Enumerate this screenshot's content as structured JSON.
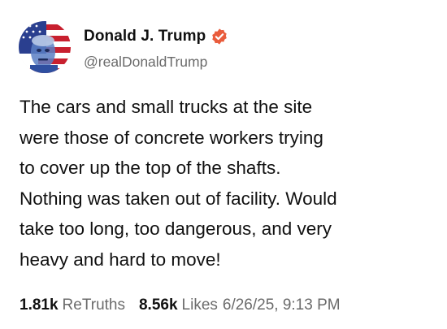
{
  "author": {
    "display_name": "Donald J. Trump",
    "handle": "@realDonaldTrump",
    "verified": true,
    "verified_color": "#e95c3c"
  },
  "post": {
    "text": "The cars and small trucks at the site\nwere those of concrete workers trying\nto cover up the top of the shafts.\nNothing was taken out of facility. Would\ntake too long, too dangerous, and very\nheavy and hard to move!"
  },
  "stats": {
    "retruths_count": "1.81k",
    "retruths_label": "ReTruths",
    "likes_count": "8.56k",
    "likes_label": "Likes",
    "timestamp": "6/26/25, 9:13 PM"
  }
}
